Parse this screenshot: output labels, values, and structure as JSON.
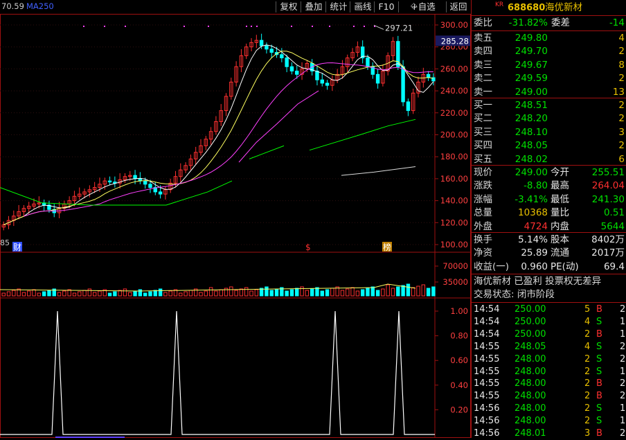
{
  "toolbar": {
    "left_readout": "70.59",
    "ma_label": "MA250",
    "buttons": [
      "复权",
      "叠加",
      "统计",
      "画线",
      "F10",
      "+自选",
      "返回"
    ]
  },
  "price_axis": {
    "ticks": [
      "300.00",
      "280.00",
      "260.00",
      "240.00",
      "220.00",
      "200.00",
      "180.00",
      "160.00",
      "140.00",
      "120.00",
      "100.00"
    ],
    "current_price_tag": "285.28",
    "high_annotation": "297.21",
    "left_bottom_label": "85"
  },
  "markers": [
    "财",
    "$",
    "榜"
  ],
  "volume_axis": {
    "ticks": [
      "70000",
      "35000"
    ]
  },
  "indicator_axis": {
    "ticks": [
      "1.00",
      "0.80",
      "0.60",
      "0.40",
      "0.20"
    ]
  },
  "stock": {
    "market": "KR",
    "code": "688680",
    "name": "海优新材"
  },
  "order_summary": {
    "wei_bi_label": "委比",
    "wei_bi_value": "-31.82%",
    "wei_cha_label": "委差",
    "wei_cha_value": "-14"
  },
  "asks": [
    {
      "label": "卖五",
      "price": "249.80",
      "qty": "4"
    },
    {
      "label": "卖四",
      "price": "249.70",
      "qty": "2"
    },
    {
      "label": "卖三",
      "price": "249.67",
      "qty": "8"
    },
    {
      "label": "卖二",
      "price": "249.59",
      "qty": "2"
    },
    {
      "label": "卖一",
      "price": "249.00",
      "qty": "13"
    }
  ],
  "bids": [
    {
      "label": "买一",
      "price": "248.51",
      "qty": "2"
    },
    {
      "label": "买二",
      "price": "248.20",
      "qty": "2"
    },
    {
      "label": "买三",
      "price": "248.10",
      "qty": "3"
    },
    {
      "label": "买四",
      "price": "248.05",
      "qty": "2"
    },
    {
      "label": "买五",
      "price": "248.02",
      "qty": "6"
    }
  ],
  "quote": [
    {
      "l1": "现价",
      "v1": "249.00",
      "c1": "green",
      "l2": "今开",
      "v2": "255.51",
      "c2": "green"
    },
    {
      "l1": "涨跌",
      "v1": "-8.80",
      "c1": "green",
      "l2": "最高",
      "v2": "264.04",
      "c2": "red"
    },
    {
      "l1": "涨幅",
      "v1": "-3.41%",
      "c1": "green",
      "l2": "最低",
      "v2": "241.30",
      "c2": "green"
    },
    {
      "l1": "总量",
      "v1": "10368",
      "c1": "yellow",
      "l2": "量比",
      "v2": "0.51",
      "c2": "green"
    },
    {
      "l1": "外盘",
      "v1": "4724",
      "c1": "red",
      "l2": "内盘",
      "v2": "5644",
      "c2": "green"
    }
  ],
  "fundamentals": [
    {
      "l1": "换手",
      "v1": "5.14%",
      "l2": "股本",
      "v2": "8402万"
    },
    {
      "l1": "净资",
      "v1": "25.89",
      "l2": "流通",
      "v2": "2017万"
    },
    {
      "l1": "收益(一)",
      "v1": "0.960",
      "l2": "PE(动)",
      "v2": "69.4"
    }
  ],
  "info_lines": [
    "海优新材 已盈利 投票权无差异",
    "交易状态: 闭市阶段"
  ],
  "trades": [
    {
      "time": "14:54",
      "price": "250.00",
      "vol": "5",
      "side": "B",
      "n": "2"
    },
    {
      "time": "14:54",
      "price": "250.00",
      "vol": "4",
      "side": "S",
      "n": "1"
    },
    {
      "time": "14:54",
      "price": "250.00",
      "vol": "2",
      "side": "B",
      "n": "1"
    },
    {
      "time": "14:55",
      "price": "248.05",
      "vol": "4",
      "side": "S",
      "n": "2"
    },
    {
      "time": "14:55",
      "price": "248.00",
      "vol": "2",
      "side": "S",
      "n": "2"
    },
    {
      "time": "14:55",
      "price": "248.00",
      "vol": "2",
      "side": "S",
      "n": "1"
    },
    {
      "time": "14:55",
      "price": "248.00",
      "vol": "2",
      "side": "B",
      "n": "2"
    },
    {
      "time": "14:55",
      "price": "248.00",
      "vol": "2",
      "side": "B",
      "n": "2"
    },
    {
      "time": "14:56",
      "price": "248.00",
      "vol": "2",
      "side": "S",
      "n": "1"
    },
    {
      "time": "14:56",
      "price": "248.00",
      "vol": "2",
      "side": "S",
      "n": "1"
    },
    {
      "time": "14:56",
      "price": "248.01",
      "vol": "3",
      "side": "B",
      "n": "2"
    }
  ],
  "colors": {
    "up": "#ff3030",
    "down": "#00ffff",
    "ma_white": "#ffffff",
    "ma_yellow": "#ffff60",
    "ma_magenta": "#ff40ff",
    "ma_green": "#00ff00",
    "grid": "#a01010"
  }
}
